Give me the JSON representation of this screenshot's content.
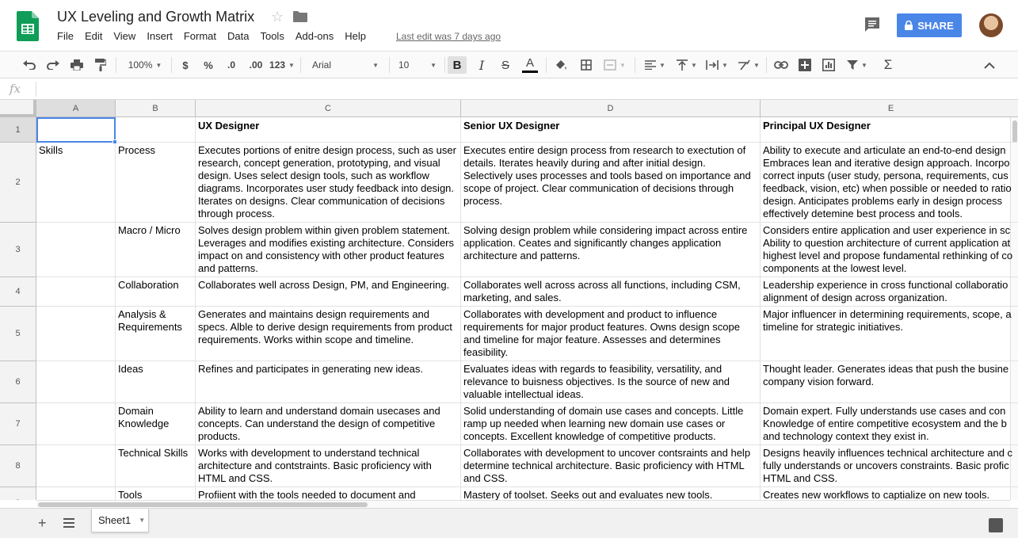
{
  "app": {
    "title": "UX Leveling and Growth Matrix",
    "menu": [
      "File",
      "Edit",
      "View",
      "Insert",
      "Format",
      "Data",
      "Tools",
      "Add-ons",
      "Help"
    ],
    "last_edit": "Last edit was 7 days ago",
    "share_label": "SHARE",
    "accent_color": "#4a86e8",
    "logo_color": "#0f9d58"
  },
  "toolbar": {
    "zoom": "100%",
    "currency": "$",
    "percent": "%",
    "dec_decrease": ".0",
    "dec_increase": ".00",
    "more_formats": "123",
    "font": "Arial",
    "font_size": "10",
    "bold": "B",
    "italic": "I",
    "strike": "S",
    "text_color": "A",
    "sigma": "Σ"
  },
  "formula_bar": {
    "fx": "fx",
    "value": ""
  },
  "grid": {
    "columns": [
      "A",
      "B",
      "C",
      "D",
      "E"
    ],
    "rows": [
      {
        "num": "1",
        "cells": [
          "",
          "",
          "UX Designer",
          "Senior UX Designer",
          "Principal UX Designer"
        ]
      },
      {
        "num": "2",
        "cells": [
          "Skills",
          "Process",
          "Executes portions of enitre design process, such as user research, concept generation, prototyping, and visual design.  Uses select design tools, such as workflow diagrams.  Incorporates user study feedback into design. Iterates on designs. Clear communication of decisions through process.",
          "Executes entire design process from research to exectution of details.  Iterates heavily during and after initial design.  Selectively uses processes and tools based on importance and scope of project.  Clear communication of decisions through process.",
          "Ability to execute and articulate an end-to-end design Embraces lean and iterative design approach. Incorpo correct inputs (user study, persona, requirements, cus feedback, vision, etc) when possible or needed to ratio design.   Anticipates problems early in design process effectively detemine best process and tools."
        ]
      },
      {
        "num": "3",
        "cells": [
          "",
          "Macro / Micro",
          "Solves design problem within given problem statement.  Leverages and modifies existing architecture. Considers impact on and consistency with other product features and patterns.",
          "Solving design problem while considering impact across entire application.  Ceates and significantly changes application architecture and patterns.",
          "Considers entire application and user experience in sc Ability to question architecture of current application at highest level and propose fundamental rethinking of co components at the lowest level."
        ]
      },
      {
        "num": "4",
        "cells": [
          "",
          "Collaboration",
          "Collaborates well across Design, PM, and Engineering.",
          "Collaborates well across across all functions, including CSM, marketing, and sales.",
          "Leadership experience in cross functional collaboratio alignment of design across organization."
        ]
      },
      {
        "num": "5",
        "cells": [
          "",
          "Analysis & Requirements",
          "Generates and maintains design requirements and specs. Alble to derive design requirements from product requirements. Works within scope and timeline.",
          "Collaborates with development and product to influence requirements for major product features.  Owns design scope and timeline for major feature. Assesses and determines feasibility.",
          "Major influencer in determining requirements, scope, a timeline for strategic initiatives."
        ]
      },
      {
        "num": "6",
        "cells": [
          "",
          "Ideas",
          "Refines and participates in generating new ideas.",
          "Evaluates ideas with regards to feasibility, versatility, and relevance to buisness objectives.  Is the source of new and valuable intellectual ideas.",
          "Thought leader. Generates ideas that push the busine company vision forward."
        ]
      },
      {
        "num": "7",
        "cells": [
          "",
          "Domain Knowledge",
          "Ability to learn and understand domain usecases and concepts. Can understand the design of competitive products.",
          "Solid understanding of domain use cases and concepts.  Little ramp up needed when learning new domain use cases or concepts.  Excellent knowledge of competitive products.",
          "Domain expert.  Fully understands use cases and con Knowledge of entire competitive ecosystem and the b and technology context they exist in."
        ]
      },
      {
        "num": "8",
        "cells": [
          "",
          "Technical Skills",
          "Works with development to understand technical architecture and contstraints. Basic proficiency with HTML and CSS.",
          "Collaborates with development to uncover contsraints and help determine technical architecture. Basic proficiency with HTML and CSS.",
          "Designs heavily influences technical architecture and c fully understands or uncovers constraints. Basic profic HTML and CSS."
        ]
      },
      {
        "num": "9",
        "cells": [
          "",
          "Tools",
          "Profiient with the tools needed to document and",
          "Mastery of toolset.  Seeks out and evaluates new tools.",
          "Creates new workflows to captialize on new tools."
        ]
      }
    ]
  },
  "sheets": {
    "active": "Sheet1"
  }
}
